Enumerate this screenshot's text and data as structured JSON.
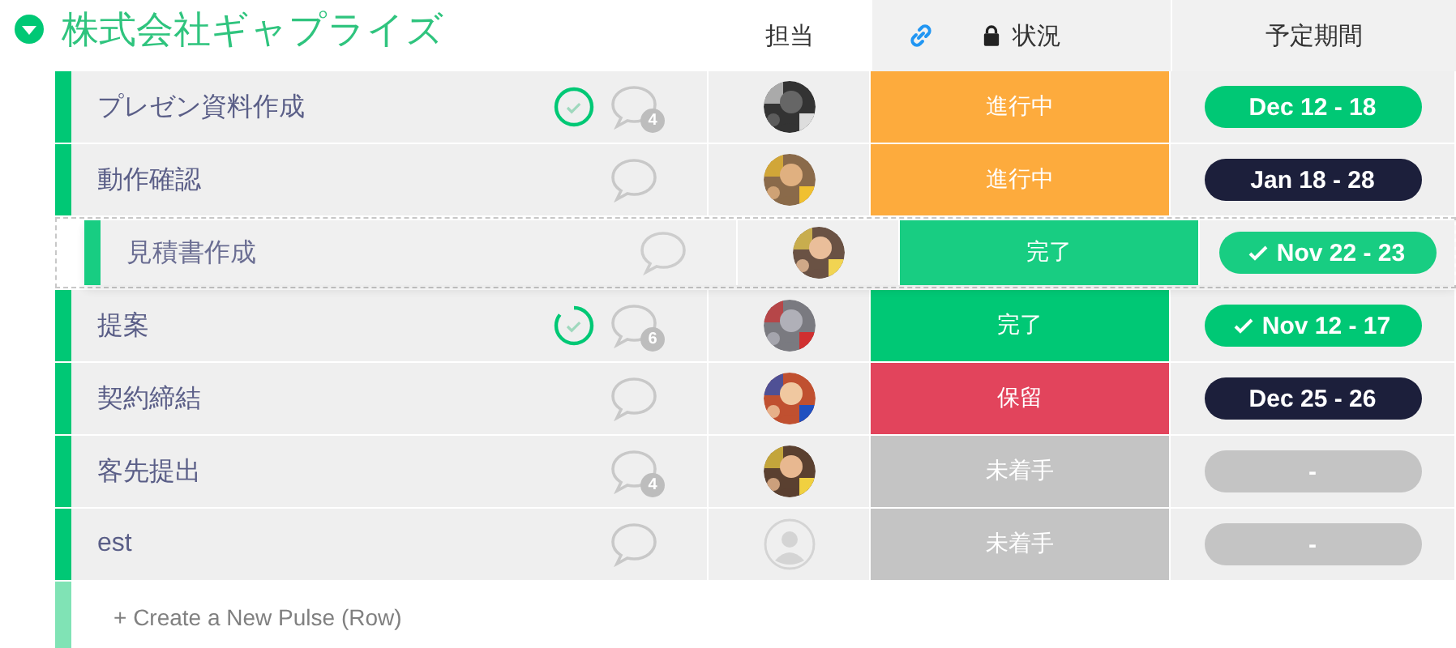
{
  "group": {
    "title": "株式会社ギャプライズ",
    "expanded": true
  },
  "columns": {
    "person": "担当",
    "status": "状況",
    "timeline": "予定期間"
  },
  "rows": [
    {
      "name": "プレゼン資料作成",
      "progress": {
        "complete": true
      },
      "comments": "4",
      "status": {
        "label": "進行中",
        "kind": "working"
      },
      "date": {
        "label": "Dec 12 - 18",
        "kind": "active",
        "done": false
      }
    },
    {
      "name": "動作確認",
      "status": {
        "label": "進行中",
        "kind": "working"
      },
      "date": {
        "label": "Jan 18 - 28",
        "kind": "future",
        "done": false
      }
    },
    {
      "name": "提案",
      "progress": {
        "complete": false
      },
      "comments": "6",
      "status": {
        "label": "完了",
        "kind": "done"
      },
      "date": {
        "label": "Nov 12 - 17",
        "kind": "active",
        "done": true
      }
    },
    {
      "name": "契約締結",
      "status": {
        "label": "保留",
        "kind": "stuck"
      },
      "date": {
        "label": "Dec 25 - 26",
        "kind": "future",
        "done": false
      }
    },
    {
      "name": "客先提出",
      "comments": "4",
      "status": {
        "label": "未着手",
        "kind": "empty"
      },
      "date": {
        "label": "-",
        "kind": "empty",
        "done": false
      }
    },
    {
      "name": "est",
      "avatar": {
        "kind": "empty"
      },
      "status": {
        "label": "未着手",
        "kind": "empty"
      },
      "date": {
        "label": "-",
        "kind": "empty",
        "done": false
      }
    }
  ],
  "dragged_row": {
    "name": "見積書作成",
    "status": {
      "label": "完了",
      "kind": "done"
    },
    "date": {
      "label": "Nov 22 - 23",
      "kind": "active",
      "done": true
    }
  },
  "create_row": {
    "label": "+ Create a New Pulse (Row)"
  }
}
